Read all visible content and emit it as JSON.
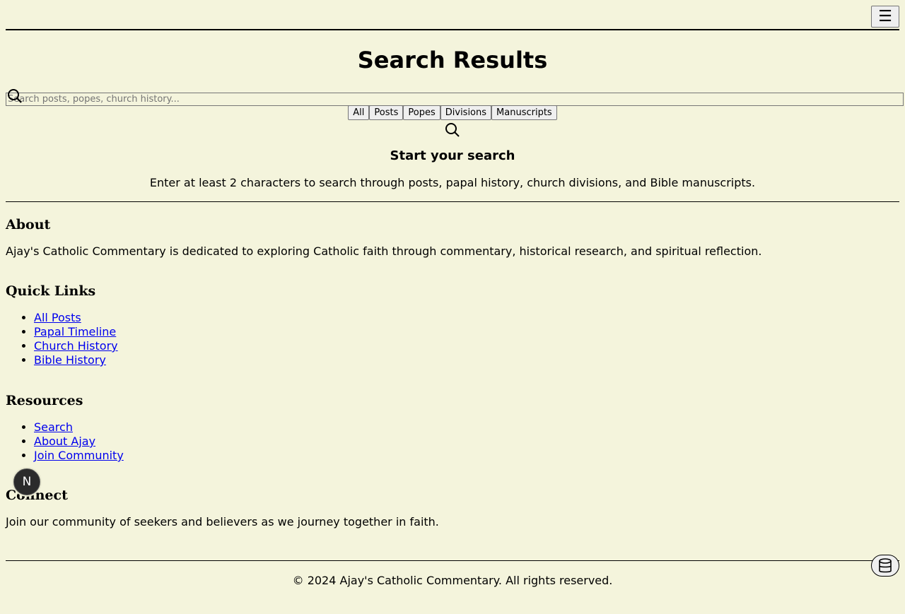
{
  "header": {
    "menu_icon": "menu-icon",
    "menu_glyph": "☰"
  },
  "page": {
    "title": "Search Results"
  },
  "search": {
    "placeholder": "Search posts, popes, church history...",
    "value": ""
  },
  "filters": [
    "All",
    "Posts",
    "Popes",
    "Divisions",
    "Manuscripts"
  ],
  "empty_state": {
    "heading": "Start your search",
    "message": "Enter at least 2 characters to search through posts, papal history, church divisions, and Bible manuscripts."
  },
  "footer": {
    "about": {
      "heading": "About",
      "text": "Ajay's Catholic Commentary is dedicated to exploring Catholic faith through commentary, historical research, and spiritual reflection."
    },
    "quick_links": {
      "heading": "Quick Links",
      "items": [
        "All Posts",
        "Papal Timeline",
        "Church History",
        "Bible History"
      ]
    },
    "resources": {
      "heading": "Resources",
      "items": [
        "Search",
        "About Ajay",
        "Join Community"
      ]
    },
    "connect": {
      "heading": "Connect",
      "text": "Join our community of seekers and believers as we journey together in faith."
    },
    "copyright": "© 2024 Ajay's Catholic Commentary. All rights reserved."
  },
  "floating": {
    "badge_letter": "N",
    "db_icon": "database-icon"
  },
  "colors": {
    "background": "#f4f4dc",
    "link": "#0000ee"
  }
}
